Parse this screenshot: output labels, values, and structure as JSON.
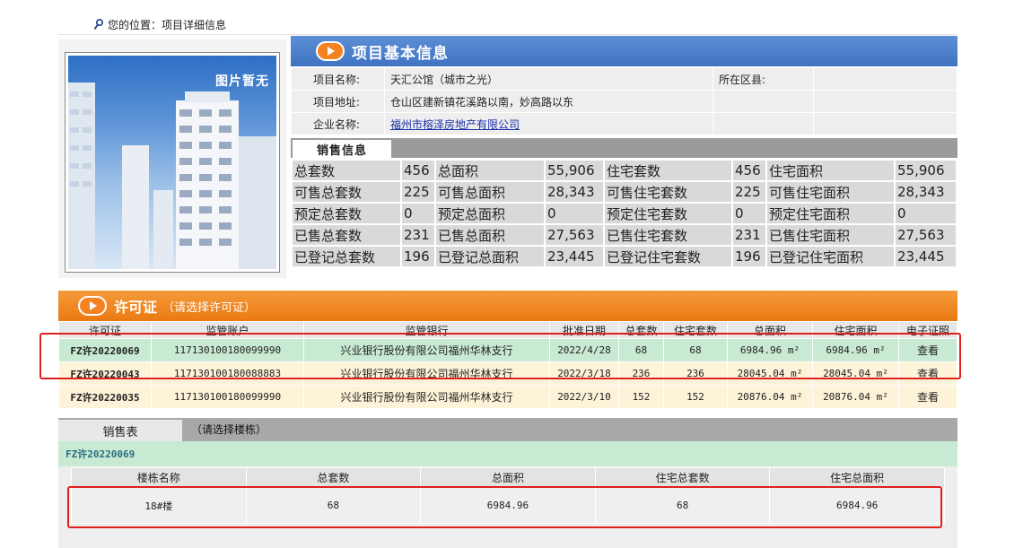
{
  "breadcrumb": {
    "text": "您的位置：项目详细信息",
    "icon": "pin-icon"
  },
  "image": {
    "placeholder": "图片暂无"
  },
  "basic_info": {
    "title": "项目基本信息",
    "rows": [
      {
        "label": "项目名称:",
        "value": "天汇公馆（城市之光）",
        "label2": "所在区县:",
        "value2": ""
      },
      {
        "label": "项目地址:",
        "value": "仓山区建新镇花溪路以南，妙高路以东",
        "label2": "",
        "value2": ""
      },
      {
        "label": "企业名称:",
        "value": "福州市榕泽房地产有限公司",
        "label2": "",
        "value2": ""
      }
    ]
  },
  "sales_info": {
    "tab": "销售信息",
    "rows": [
      [
        "总套数",
        "456",
        "总面积",
        "55,906",
        "住宅套数",
        "456",
        "住宅面积",
        "55,906"
      ],
      [
        "可售总套数",
        "225",
        "可售总面积",
        "28,343",
        "可售住宅套数",
        "225",
        "可售住宅面积",
        "28,343"
      ],
      [
        "预定总套数",
        "0",
        "预定总面积",
        "0",
        "预定住宅套数",
        "0",
        "预定住宅面积",
        "0"
      ],
      [
        "已售总套数",
        "231",
        "已售总面积",
        "27,563",
        "已售住宅套数",
        "231",
        "已售住宅面积",
        "27,563"
      ],
      [
        "已登记总套数",
        "196",
        "已登记总面积",
        "23,445",
        "已登记住宅套数",
        "196",
        "已登记住宅面积",
        "23,445"
      ]
    ]
  },
  "permits": {
    "title": "许可证",
    "hint": "（请选择许可证）",
    "headers": [
      "许可证",
      "监管账户",
      "监管银行",
      "批准日期",
      "总套数",
      "住宅套数",
      "总面积",
      "住宅面积",
      "电子证照"
    ],
    "rows": [
      {
        "id": "FZ许20220069",
        "account": "117130100180099990",
        "bank": "兴业银行股份有限公司福州华林支行",
        "date": "2022/4/28",
        "total": "68",
        "residential": "68",
        "area": "6984.96 m²",
        "res_area": "6984.96 m²",
        "view": "查看"
      },
      {
        "id": "FZ许20220043",
        "account": "117130100180088883",
        "bank": "兴业银行股份有限公司福州华林支行",
        "date": "2022/3/18",
        "total": "236",
        "residential": "236",
        "area": "28045.04 m²",
        "res_area": "28045.04 m²",
        "view": "查看"
      },
      {
        "id": "FZ许20220035",
        "account": "117130100180099990",
        "bank": "兴业银行股份有限公司福州华林支行",
        "date": "2022/3/10",
        "total": "152",
        "residential": "152",
        "area": "20876.04 m²",
        "res_area": "20876.04 m²",
        "view": "查看"
      }
    ]
  },
  "sales_sheet": {
    "tab": "销售表",
    "hint": "（请选择楼栋）",
    "permit_label": "FZ许20220069",
    "headers": [
      "楼栋名称",
      "总套数",
      "总面积",
      "住宅总套数",
      "住宅总面积"
    ],
    "rows": [
      {
        "name": "18#楼",
        "total": "68",
        "area": "6984.96",
        "res_total": "68",
        "res_area": "6984.96"
      }
    ]
  }
}
